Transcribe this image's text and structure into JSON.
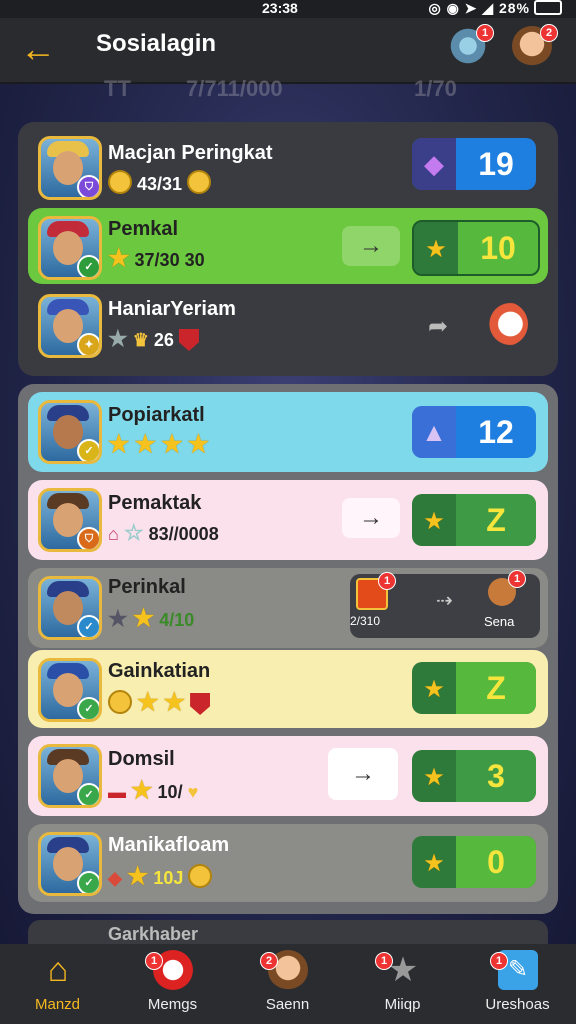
{
  "status": {
    "time": "23:38",
    "battery": "28%"
  },
  "header": {
    "title": "Sosialagin",
    "back_icon": "arrow-left-icon",
    "settings_badge": "1",
    "profile_badge": "2"
  },
  "behind": {
    "left": "TT",
    "mid": "7/711/000",
    "right": "1/70"
  },
  "top_section": {
    "rows": [
      {
        "name": "Macjan Peringkat",
        "sub": "43/31",
        "score": "19",
        "score_icon": "gem-icon"
      },
      {
        "name": "Pemkal",
        "sub": "37/30 30",
        "score": "10",
        "score_icon": "star-icon"
      },
      {
        "name": "HaniarYeriam",
        "sub": "26"
      }
    ]
  },
  "list": {
    "rows": [
      {
        "name": "Popiarkatl",
        "score": "12",
        "score_icon": "cat-icon"
      },
      {
        "name": "Pemaktak",
        "sub": "83//0008",
        "score": "Z",
        "score_icon": "star-icon"
      },
      {
        "name": "Perinkal",
        "sub": "4/10",
        "reward_label": "2/310",
        "friend_label": "Sena",
        "reward_badge": "1",
        "friend_badge": "1"
      },
      {
        "name": "Gainkatian",
        "score": "Z",
        "score_icon": "star-icon"
      },
      {
        "name": "Domsil",
        "sub": "10/",
        "score": "3",
        "score_icon": "star-icon"
      },
      {
        "name": "Manikafloam",
        "sub": "10J",
        "score": "0",
        "score_icon": "star-icon"
      },
      {
        "name": "Garkhaber"
      }
    ]
  },
  "nav": [
    {
      "label": "Manzd",
      "badge": ""
    },
    {
      "label": "Memgs",
      "badge": "1"
    },
    {
      "label": "Saenn",
      "badge": "2"
    },
    {
      "label": "Miiqp",
      "badge": "1"
    },
    {
      "label": "Ureshoas",
      "badge": "1"
    }
  ],
  "colors": {
    "accent": "#f6b820",
    "green": "#6cc83f",
    "cyan": "#7ed9ea",
    "pink": "#fbe1ec",
    "cream": "#f8eeb0"
  }
}
